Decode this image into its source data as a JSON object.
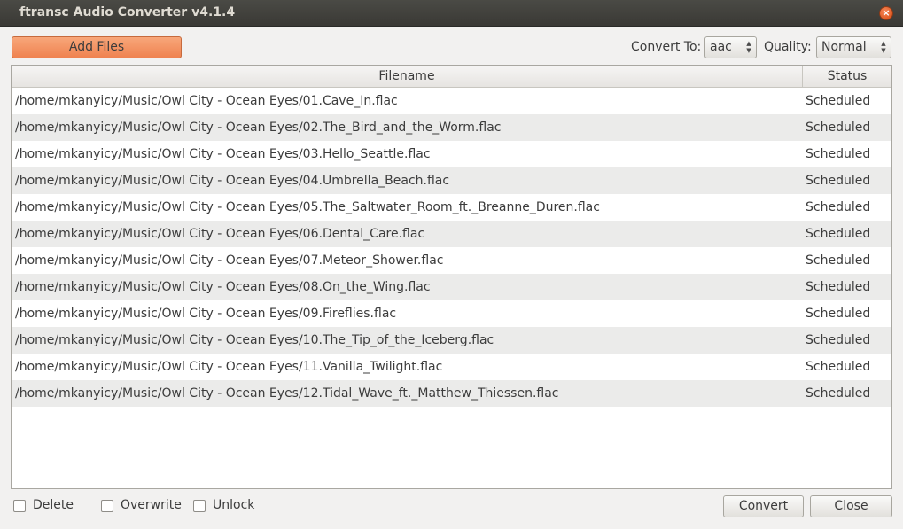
{
  "window": {
    "title": "ftransc Audio Converter v4.1.4",
    "close_icon": "×"
  },
  "toolbar": {
    "add_files_label": "Add Files",
    "convert_to_label": "Convert To:",
    "convert_to_value": "aac",
    "quality_label": "Quality:",
    "quality_value": "Normal"
  },
  "table": {
    "columns": [
      "Filename",
      "Status"
    ],
    "rows": [
      {
        "filename": "/home/mkanyicy/Music/Owl City - Ocean Eyes/01.Cave_In.flac",
        "status": "Scheduled"
      },
      {
        "filename": "/home/mkanyicy/Music/Owl City - Ocean Eyes/02.The_Bird_and_the_Worm.flac",
        "status": "Scheduled"
      },
      {
        "filename": "/home/mkanyicy/Music/Owl City - Ocean Eyes/03.Hello_Seattle.flac",
        "status": "Scheduled"
      },
      {
        "filename": "/home/mkanyicy/Music/Owl City - Ocean Eyes/04.Umbrella_Beach.flac",
        "status": "Scheduled"
      },
      {
        "filename": "/home/mkanyicy/Music/Owl City - Ocean Eyes/05.The_Saltwater_Room_ft._Breanne_Duren.flac",
        "status": "Scheduled"
      },
      {
        "filename": "/home/mkanyicy/Music/Owl City - Ocean Eyes/06.Dental_Care.flac",
        "status": "Scheduled"
      },
      {
        "filename": "/home/mkanyicy/Music/Owl City - Ocean Eyes/07.Meteor_Shower.flac",
        "status": "Scheduled"
      },
      {
        "filename": "/home/mkanyicy/Music/Owl City - Ocean Eyes/08.On_the_Wing.flac",
        "status": "Scheduled"
      },
      {
        "filename": "/home/mkanyicy/Music/Owl City - Ocean Eyes/09.Fireflies.flac",
        "status": "Scheduled"
      },
      {
        "filename": "/home/mkanyicy/Music/Owl City - Ocean Eyes/10.The_Tip_of_the_Iceberg.flac",
        "status": "Scheduled"
      },
      {
        "filename": "/home/mkanyicy/Music/Owl City - Ocean Eyes/11.Vanilla_Twilight.flac",
        "status": "Scheduled"
      },
      {
        "filename": "/home/mkanyicy/Music/Owl City - Ocean Eyes/12.Tidal_Wave_ft._Matthew_Thiessen.flac",
        "status": "Scheduled"
      }
    ]
  },
  "options": {
    "delete_label": "Delete",
    "overwrite_label": "Overwrite",
    "unlock_label": "Unlock"
  },
  "actions": {
    "convert_label": "Convert",
    "close_label": "Close"
  },
  "colors": {
    "accent_button": "#ef8250",
    "titlebar": "#3c3b37",
    "alt_row": "#ebebea"
  }
}
